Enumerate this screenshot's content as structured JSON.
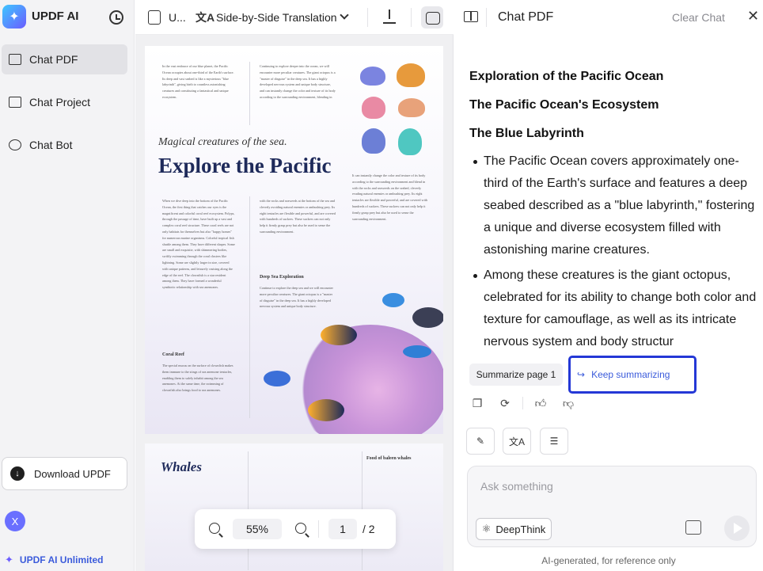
{
  "sidebar": {
    "brand": "UPDF AI",
    "items": [
      {
        "label": "Chat PDF",
        "icon": "book-icon",
        "active": true
      },
      {
        "label": "Chat Project",
        "icon": "folder-icon",
        "active": false
      },
      {
        "label": "Chat Bot",
        "icon": "bot-icon",
        "active": false
      }
    ],
    "download_label": "Download UPDF",
    "avatar_initial": "X",
    "unlimited_label": "UPDF AI Unlimited"
  },
  "viewer": {
    "file_name": "U...",
    "mode_label": "Side-by-Side Translation",
    "page1": {
      "tagline": "Magical creatures of the sea.",
      "headline": "Explore the Pacific",
      "section_deep_sea": "Deep Sea Exploration",
      "section_coral": "Coral Reef",
      "body_col1": "In the vast embrace of our blue planet, the Pacific Ocean occupies about one-third of the Earth's surface. Its deep and vast seabed is like a mysterious \"blue labyrinth\", giving birth to countless astonishing creatures and constituting a fantastical and unique ecosystem.",
      "body_col2": "Continuing to explore deeper into the ocean, we will encounter more peculiar creatures. The giant octopus is a \"master of disguise\" in the deep sea. It has a highly developed nervous system and unique body structure, and can instantly change the color and texture of its body according to the surrounding environment, blending in",
      "body_col3": "It can instantly change the color and texture of its body according to the surrounding environment and blend in with the rocks and seaweeds on the seabed, cleverly evading natural enemies or ambushing prey. Its eight tentacles are flexible and powerful, and are covered with hundreds of suckers. These suckers can not only help it firmly grasp prey but also be used to sense the surrounding environment.",
      "body_col4": "When we dive deep into the bottom of the Pacific Ocean, the first thing that catches our eyes is the magnificent and colorful coral reef ecosystem. Polyps, through the passage of time, have built up a vast and complex coral reef structure. These coral reefs are not only habitats for themselves but also \"happy homes\" for numerous marine organisms. Colorful tropical fish shuttle among them. They have different shapes. Some are small and exquisite, with shimmering bodies, swiftly swimming through the coral clusters like lightning. Some are slightly larger in size, covered with unique patterns, and leisurely cruising along the edge of the reef. The clownfish is a star resident among them. They have formed a wonderful symbiotic relationship with sea anemones.",
      "body_col5": "with the rocks and seaweeds at the bottom of the sea and cleverly avoiding natural enemies or ambushing prey. Its eight tentacles are flexible and powerful, and are covered with hundreds of suckers. These suckers can not only help it firmly grasp prey but also be used to sense the surrounding environment.",
      "body_col6": "Continue to explore the deep sea and we will encounter more peculiar creatures. The giant octopus is a \"master of disguise\" in the deep sea. It has a highly developed nervous system and unique body structure.",
      "body_col7": "The special mucus on the surface of clownfish makes them immune to the stings of sea anemone tentacles, enabling them to safely inhabit among the sea anemones. At the same time, the swimming of clownfish also brings food to sea anemones."
    },
    "page2": {
      "title": "Whales",
      "subtitle": "Food of baleen whales"
    },
    "zoom": "55%",
    "current_page": "1",
    "total_pages": "/ 2"
  },
  "chat": {
    "title": "Chat PDF",
    "clear_label": "Clear Chat",
    "headings": [
      "Exploration of the Pacific Ocean",
      "The Pacific Ocean's Ecosystem",
      "The Blue Labyrinth"
    ],
    "bullets": [
      "The Pacific Ocean covers approximately one-third of the Earth's surface and features a deep seabed described as a \"blue labyrinth,\" fostering a unique and diverse ecosystem filled with astonishing marine creatures.",
      "Among these creatures is the giant octopus, celebrated for its ability to change both color and texture for camouflage, as well as its intricate nervous system and body structur"
    ],
    "summarize_chip": "Summarize page 1",
    "keep_chip": "Keep summarizing",
    "input_placeholder": "Ask something",
    "deepthink_label": "DeepThink",
    "disclaimer": "AI-generated, for reference only"
  },
  "colors": {
    "accent": "#3b5bdb",
    "highlight_border": "#2438d6",
    "sidebar_bg": "#f3f3f5"
  }
}
